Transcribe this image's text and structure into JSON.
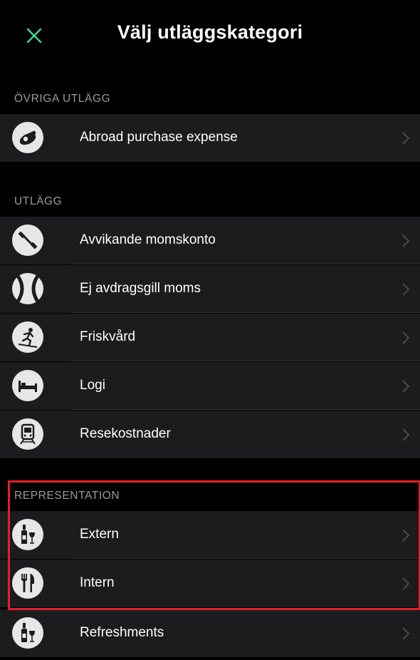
{
  "header": {
    "title": "Välj utläggskategori",
    "close_icon": "close-icon",
    "accent_color": "#3ddc97"
  },
  "sections": [
    {
      "title": "ÖVRIGA UTLÄGG",
      "items": [
        {
          "label": "Abroad purchase expense",
          "icon": "whistle-icon"
        }
      ]
    },
    {
      "title": "UTLÄGG",
      "items": [
        {
          "label": "Avvikande momskonto",
          "icon": "dumbbell-icon"
        },
        {
          "label": "Ej avdragsgill moms",
          "icon": "tennis-ball-icon"
        },
        {
          "label": "Friskvård",
          "icon": "skier-icon"
        },
        {
          "label": "Logi",
          "icon": "bed-icon"
        },
        {
          "label": "Resekostnader",
          "icon": "train-icon"
        }
      ]
    },
    {
      "title": "REPRESENTATION",
      "items": [
        {
          "label": "Extern",
          "icon": "wine-bottle-glass-icon"
        },
        {
          "label": "Intern",
          "icon": "fork-knife-icon"
        },
        {
          "label": "Refreshments",
          "icon": "wine-bottle-glass-icon"
        }
      ]
    }
  ],
  "highlight_color": "#e0202a"
}
